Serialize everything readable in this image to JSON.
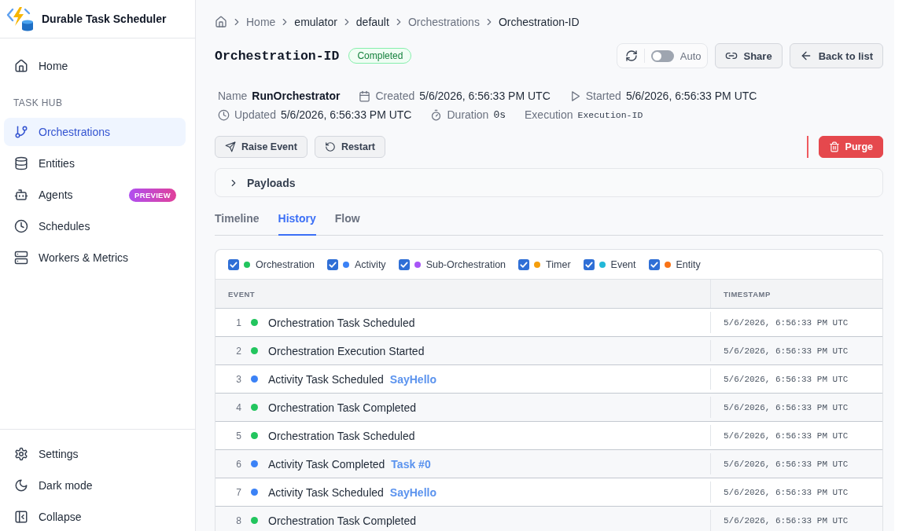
{
  "sidebar": {
    "title": "Durable Task Scheduler",
    "top_items": [
      {
        "label": "Home",
        "selected": false
      }
    ],
    "section_label": "TASK HUB",
    "hub_items": [
      {
        "label": "Orchestrations",
        "selected": true
      },
      {
        "label": "Entities",
        "selected": false
      },
      {
        "label": "Agents",
        "selected": false,
        "badge": "PREVIEW"
      },
      {
        "label": "Schedules",
        "selected": false
      },
      {
        "label": "Workers & Metrics",
        "selected": false
      }
    ],
    "footer_items": [
      {
        "label": "Settings"
      },
      {
        "label": "Dark mode"
      },
      {
        "label": "Collapse"
      }
    ]
  },
  "breadcrumb": [
    {
      "label": "Home",
      "link": true
    },
    {
      "label": "emulator",
      "link": false
    },
    {
      "label": "default",
      "link": false
    },
    {
      "label": "Orchestrations",
      "link": true
    },
    {
      "label": "Orchestration-ID",
      "link": false
    }
  ],
  "header": {
    "title": "Orchestration-ID",
    "status": "Completed",
    "auto_refresh": false,
    "auto_label": "Auto",
    "share": "Share",
    "back": "Back to list"
  },
  "details": [
    [
      {
        "label": "Name",
        "value": "RunOrchestrator",
        "kind": "strong"
      },
      {
        "label": "Created",
        "value": "5/6/2026, 6:56:33 PM UTC",
        "kind": "plain"
      },
      {
        "label": "Started",
        "value": "5/6/2026, 6:56:33 PM UTC",
        "kind": "plain"
      }
    ],
    [
      {
        "label": "Updated",
        "value": "5/6/2026, 6:56:33 PM UTC",
        "kind": "plain"
      },
      {
        "label": "Duration",
        "value": "0s",
        "kind": "mono"
      },
      {
        "label": "Execution",
        "value": "Execution-ID",
        "kind": "code"
      }
    ]
  ],
  "actions": [
    "Raise Event",
    "Restart"
  ],
  "purge": "Purge",
  "payloads": {
    "label": "Payloads",
    "expanded": false
  },
  "tabs": [
    {
      "label": "Timeline",
      "selected": false
    },
    {
      "label": "History",
      "selected": true
    },
    {
      "label": "Flow",
      "selected": false
    }
  ],
  "history": {
    "filters": [
      {
        "label": "Orchestration",
        "checked": true,
        "color": "#22c55e"
      },
      {
        "label": "Activity",
        "checked": true,
        "color": "#3b82f6"
      },
      {
        "label": "Sub-Orchestration",
        "checked": true,
        "color": "#a855f7"
      },
      {
        "label": "Timer",
        "checked": true,
        "color": "#f59e0b"
      },
      {
        "label": "Event",
        "checked": true,
        "color": "#22b8d8"
      },
      {
        "label": "Entity",
        "checked": true,
        "color": "#f97316"
      }
    ],
    "columns": [
      "EVENT",
      "TIMESTAMP"
    ],
    "rows": [
      {
        "number": "1",
        "color": "#22c55e",
        "event": "Orchestration Task Scheduled",
        "timestamp": "5/6/2026, 6:56:33 PM UTC"
      },
      {
        "number": "2",
        "color": "#22c55e",
        "event": "Orchestration Execution Started",
        "timestamp": "5/6/2026, 6:56:33 PM UTC"
      },
      {
        "number": "3",
        "color": "#3b82f6",
        "event": "Activity Task Scheduled",
        "detail": "SayHello",
        "timestamp": "5/6/2026, 6:56:33 PM UTC"
      },
      {
        "number": "4",
        "color": "#22c55e",
        "event": "Orchestration Task Completed",
        "timestamp": "5/6/2026, 6:56:33 PM UTC"
      },
      {
        "number": "5",
        "color": "#22c55e",
        "event": "Orchestration Task Scheduled",
        "timestamp": "5/6/2026, 6:56:33 PM UTC"
      },
      {
        "number": "6",
        "color": "#3b82f6",
        "event": "Activity Task Completed",
        "detail": "Task #0",
        "timestamp": "5/6/2026, 6:56:33 PM UTC"
      },
      {
        "number": "7",
        "color": "#3b82f6",
        "event": "Activity Task Scheduled",
        "detail": "SayHello",
        "timestamp": "5/6/2026, 6:56:33 PM UTC"
      },
      {
        "number": "8",
        "color": "#22c55e",
        "event": "Orchestration Task Completed",
        "timestamp": "5/6/2026, 6:56:33 PM UTC"
      }
    ]
  }
}
